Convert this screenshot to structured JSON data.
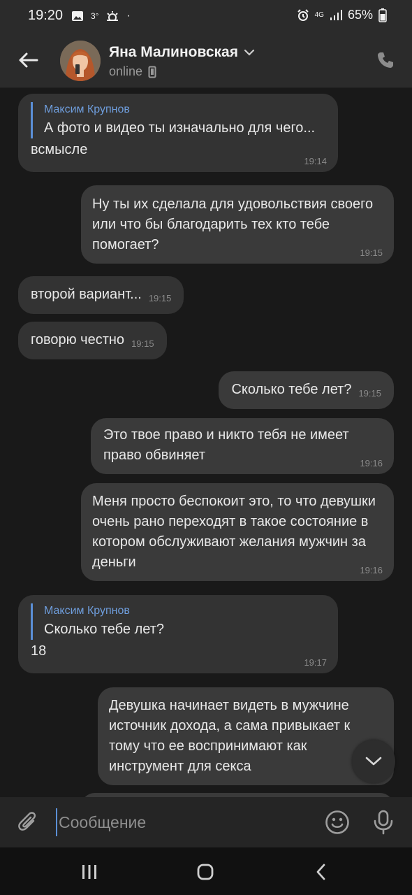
{
  "status_bar": {
    "time": "19:20",
    "temperature": "3°",
    "network": "4G",
    "battery": "65%",
    "icons": [
      "image-notification-icon",
      "weather-icon",
      "alarm-icon",
      "signal-icon",
      "battery-icon"
    ]
  },
  "header": {
    "contact_name": "Яна Малиновская",
    "status": "online",
    "icons": [
      "back-arrow-icon",
      "chevron-down-icon",
      "phone-device-icon",
      "call-icon"
    ]
  },
  "messages": [
    {
      "dir": "in",
      "reply_author": "Максим Крупнов",
      "reply_text": "А фото и видео ты изначально для чего...",
      "text": "всмысле",
      "time": "19:14"
    },
    {
      "dir": "out",
      "text": "Ну  ты их сделала для удовольствия своего или что бы благодарить тех кто тебе помогает?",
      "time": "19:15"
    },
    {
      "dir": "in",
      "text": "второй вариант...",
      "time": "19:15"
    },
    {
      "dir": "in",
      "text": "говорю честно",
      "time": "19:15"
    },
    {
      "dir": "out",
      "text": "Сколько тебе лет?",
      "time": "19:15"
    },
    {
      "dir": "out",
      "text": "Это твое право и никто тебя не имеет право обвиняет",
      "time": "19:16"
    },
    {
      "dir": "out",
      "text": "Меня просто беспокоит это, то что девушки очень рано переходят в такое состояние в котором обслуживают желания мужчин за деньги",
      "time": "19:16"
    },
    {
      "dir": "in",
      "reply_author": "Максим Крупнов",
      "reply_text": "Сколько тебе лет?",
      "text": "18",
      "time": "19:17"
    },
    {
      "dir": "out",
      "text": "Девушка начинает видеть в мужчине источник дохода, а сама привыкает к тому что ее воспринимают как инструмент для секса",
      "time": ""
    }
  ],
  "composer": {
    "placeholder": "Сообщение",
    "value": "",
    "icons": [
      "attach-icon",
      "emoji-icon",
      "microphone-icon",
      "scroll-down-icon"
    ]
  },
  "colors": {
    "background": "#191919",
    "header": "#2b2b2b",
    "bubble_in": "#333333",
    "bubble_out": "#3a3a3a",
    "accent": "#5b8fd6"
  }
}
